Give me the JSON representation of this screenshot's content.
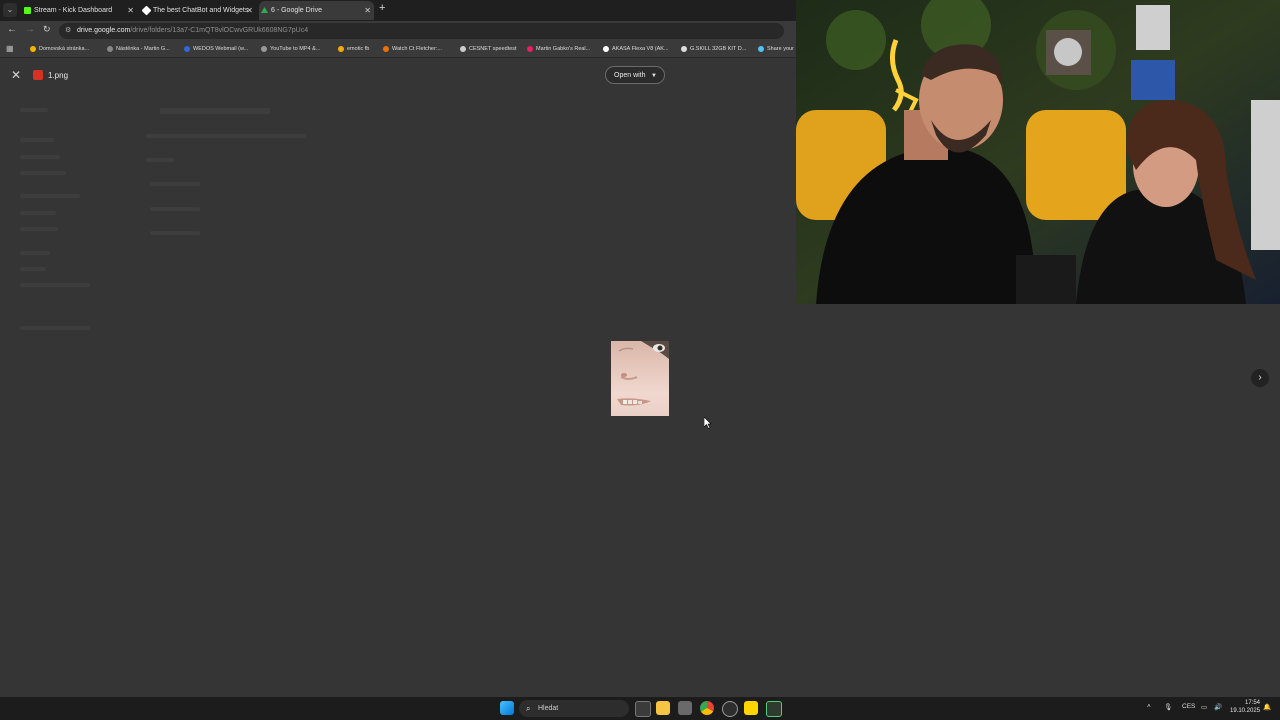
{
  "browser": {
    "tabs": [
      {
        "title": "Stream - Kick Dashboard",
        "favicon_color": "#53fc18",
        "active": false
      },
      {
        "title": "The best ChatBot and Widgets",
        "favicon_color": "#ffffff",
        "active": false
      },
      {
        "title": "6 - Google Drive",
        "favicon_color": "#34a853",
        "active": true
      }
    ],
    "new_tab": "+",
    "url_domain": "drive.google.com",
    "url_path": "/drive/folders/13a7-C1mQT8vlOCwvGRUk6608NG7pUc4",
    "bookmarks": [
      {
        "label": "Domovská stránka...",
        "color": "#f4b400"
      },
      {
        "label": "Nástěnka - Martin G...",
        "color": "#888888"
      },
      {
        "label": "WEDOS Webmail (w...",
        "color": "#3367d6"
      },
      {
        "label": "YouTube to MP4 &...",
        "color": "#999999"
      },
      {
        "label": "emotic fb",
        "color": "#f9ab00"
      },
      {
        "label": "Watch Ct Fletcher:...",
        "color": "#e8710a"
      },
      {
        "label": "CESNET speedtest",
        "color": "#cccccc"
      },
      {
        "label": "Martin Gabko's Real...",
        "color": "#e91e63"
      },
      {
        "label": "AKASA Flexa V8 (AK...",
        "color": "#ffffff"
      },
      {
        "label": "G.SKILL 32GB KIT D...",
        "color": "#dddddd"
      },
      {
        "label": "Share your",
        "color": "#4fc3f7"
      }
    ]
  },
  "viewer": {
    "file_name": "1.png",
    "open_with_label": "Open with"
  },
  "taskbar": {
    "search_placeholder": "Hledat",
    "language": "CES",
    "time": "17:54",
    "date": "19.10.2025"
  },
  "colors": {
    "background": "#353535",
    "chrome_dark": "#1f1f1f",
    "chrome_mid": "#3a3a3a"
  }
}
